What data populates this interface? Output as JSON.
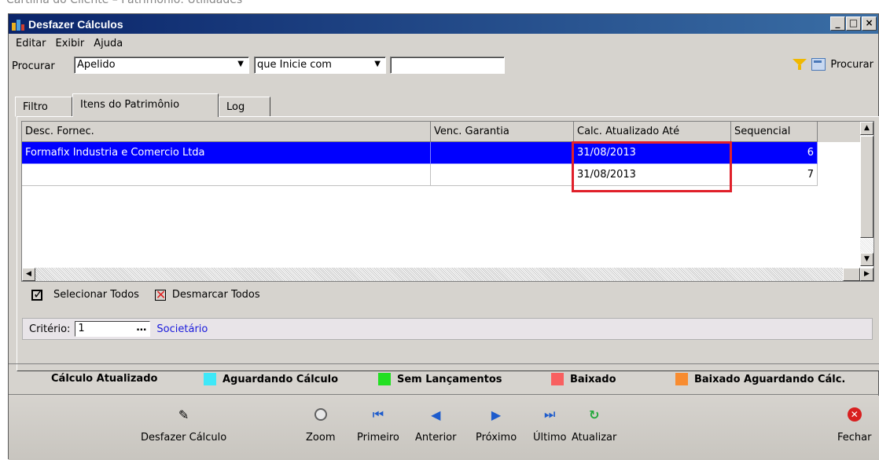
{
  "page_caption": "Cartilha do Cliente – Patrimônio: Utilidades",
  "window": {
    "title": "Desfazer Cálculos",
    "btn_min": "_",
    "btn_max": "□",
    "btn_close": "×"
  },
  "menu": [
    "Editar",
    "Exibir",
    "Ajuda"
  ],
  "search": {
    "label": "Procurar",
    "field_value": "Apelido",
    "condition_value": "que Inicie com",
    "text_value": "",
    "button_label": "Procurar"
  },
  "tabs": [
    "Filtro",
    "Itens do Patrimônio",
    "Log"
  ],
  "grid": {
    "columns": [
      "Desc. Fornec.",
      "Venc. Garantia",
      "Calc. Atualizado Até",
      "Sequencial"
    ],
    "rows": [
      {
        "fornec": "Formafix Industria e Comercio Ltda",
        "garantia": "",
        "calc": "31/08/2013",
        "seq": "6",
        "selected": true
      },
      {
        "fornec": "",
        "garantia": "",
        "calc": "31/08/2013",
        "seq": "7",
        "selected": false
      }
    ]
  },
  "selection": {
    "select_all": "Selecionar Todos",
    "deselect_all": "Desmarcar Todos"
  },
  "criterio": {
    "label": "Critério:",
    "value": "1",
    "description": "Societário"
  },
  "legend": [
    {
      "label": "Cálculo Atualizado",
      "color": "#ffffff"
    },
    {
      "label": "Aguardando Cálculo",
      "color": "#3ee8f8"
    },
    {
      "label": "Sem Lançamentos",
      "color": "#22e022"
    },
    {
      "label": "Baixado",
      "color": "#f86060"
    },
    {
      "label": "Baixado Aguardando Cálc.",
      "color": "#f88c30"
    }
  ],
  "toolbar": {
    "desfazer": "Desfazer Cálculo",
    "zoom": "Zoom",
    "primeiro": "Primeiro",
    "anterior": "Anterior",
    "proximo": "Próximo",
    "ultimo": "Último",
    "atualizar": "Atualizar",
    "fechar": "Fechar"
  },
  "colors": {
    "highlight_box": "#e0202a",
    "selection": "#0000ff",
    "title_bar": "#0a246a"
  }
}
